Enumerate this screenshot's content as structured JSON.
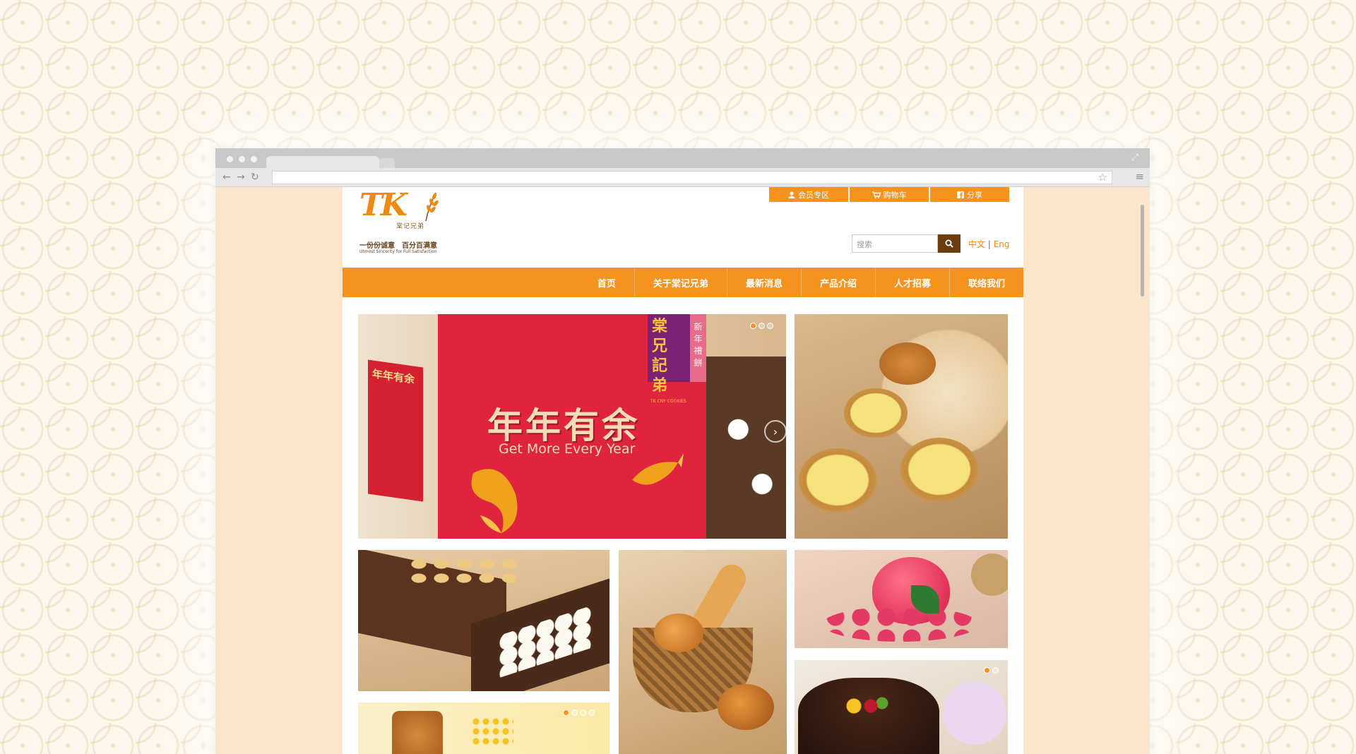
{
  "browser": {
    "fullscreen_icon": "expand-icon"
  },
  "site": {
    "logo": {
      "mark": "TK",
      "name": "棠记兄弟",
      "slogan": "一份份诚意　百分百满意",
      "slogan_en": "Utmost Sincerity for Full Satisfaction"
    },
    "top_buttons": [
      {
        "label": "会员专区",
        "icon": "user-icon"
      },
      {
        "label": "购物车",
        "icon": "cart-icon"
      },
      {
        "label": "分享",
        "icon": "facebook-icon"
      }
    ],
    "search": {
      "placeholder": "搜索",
      "button_icon": "search-icon"
    },
    "lang": {
      "zh": "中文",
      "sep": "|",
      "en": "Eng"
    },
    "nav": [
      "首页",
      "关于棠记兄弟",
      "最新消息",
      "产品介绍",
      "人才招募",
      "联络我们"
    ],
    "banner": {
      "title_cn": "年年有余",
      "title_en": "Get More Every Year",
      "box_title": "年年有余",
      "badge_name": "棠兄記弟",
      "badge_sub": "TK CNY COOKIES",
      "side_tag": "新年禮餅"
    },
    "colors": {
      "accent": "#f5931e",
      "banner_red": "#e0243e",
      "brown": "#6b3e10"
    }
  }
}
